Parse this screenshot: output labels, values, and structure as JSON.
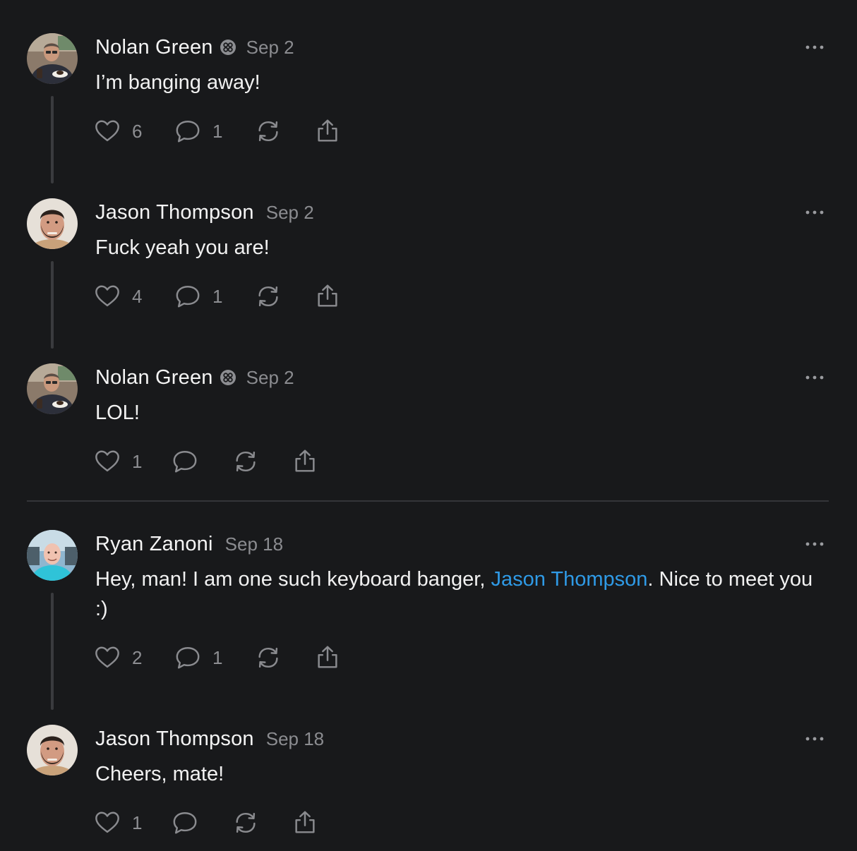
{
  "posts": [
    {
      "author": "Nolan Green",
      "date": "Sep 2",
      "text": "I’m banging away!",
      "likes": "6",
      "replies": "1",
      "avatar_icon": "avatar-nolan-green",
      "verified": true
    },
    {
      "author": "Jason Thompson",
      "date": "Sep 2",
      "text": "Fuck yeah you are!",
      "likes": "4",
      "replies": "1",
      "avatar_icon": "avatar-jason-thompson",
      "verified": false
    },
    {
      "author": "Nolan Green",
      "date": "Sep 2",
      "text": "LOL!",
      "likes": "1",
      "replies": "",
      "avatar_icon": "avatar-nolan-green",
      "verified": true
    },
    {
      "author": "Ryan Zanoni",
      "date": "Sep 18",
      "text_before": "Hey, man! I am one such keyboard banger, ",
      "mention": "Jason Thompson",
      "text_after": ". Nice to meet you :)",
      "likes": "2",
      "replies": "1",
      "avatar_icon": "avatar-ryan-zanoni",
      "verified": false
    },
    {
      "author": "Jason Thompson",
      "date": "Sep 18",
      "text": "Cheers, mate!",
      "likes": "1",
      "replies": "",
      "avatar_icon": "avatar-jason-thompson",
      "verified": false
    }
  ],
  "icons": {
    "like": "heart-icon",
    "reply": "comment-icon",
    "repost": "repost-icon",
    "share": "share-icon",
    "more": "more-options-icon",
    "badge": "verified-badge-icon"
  },
  "colors": {
    "background": "#18191b",
    "mention": "#2f9ae6",
    "muted": "#8b8c90",
    "thread_line": "#3a3b3e"
  }
}
